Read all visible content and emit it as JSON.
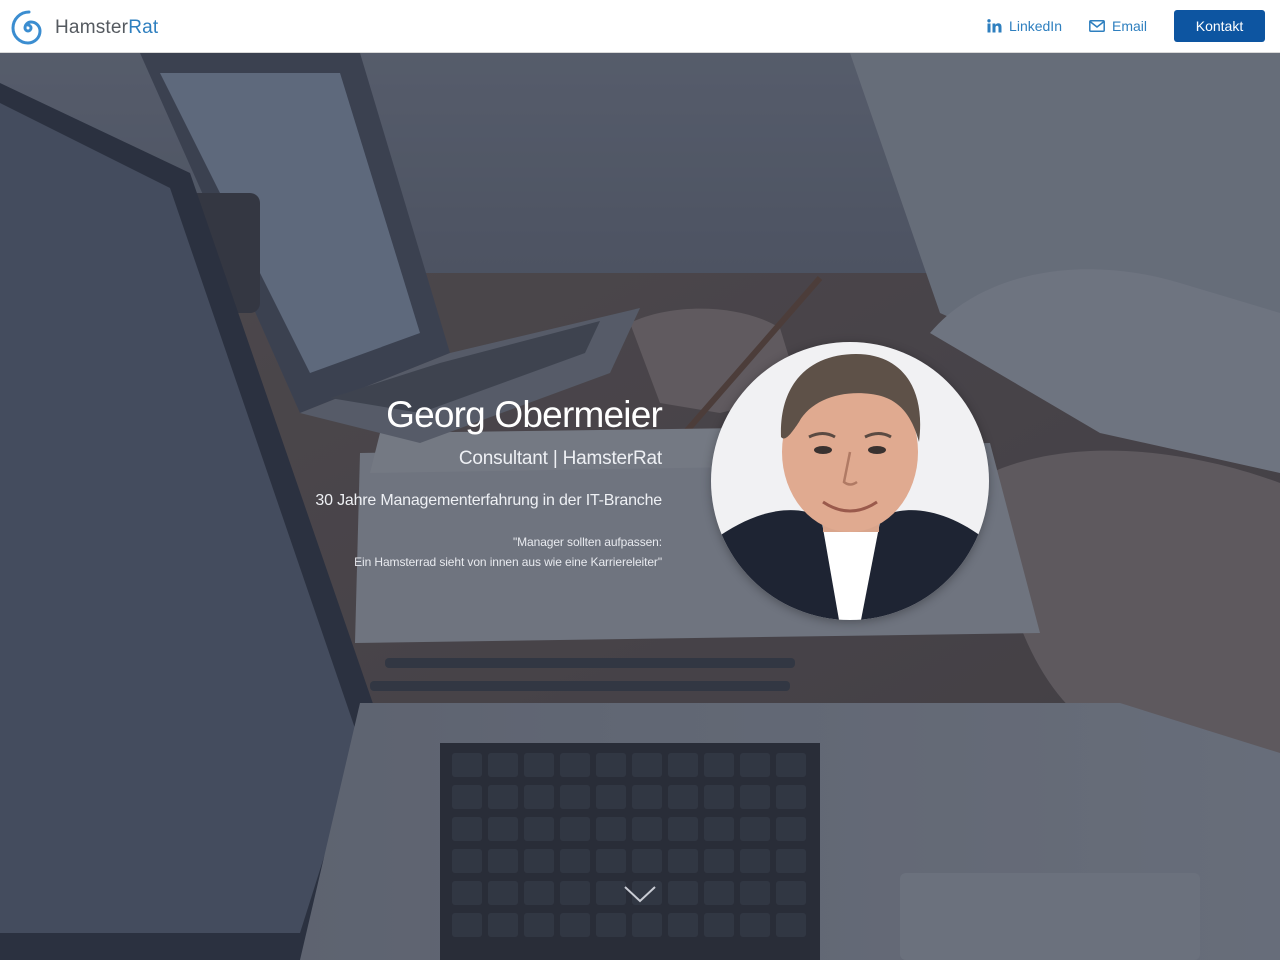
{
  "brand": {
    "name_part1": "Hamster",
    "name_part2": "Rat"
  },
  "nav": {
    "linkedin_label": "LinkedIn",
    "email_label": "Email",
    "contact_label": "Kontakt"
  },
  "hero": {
    "name": "Georg Obermeier",
    "role": "Consultant | HamsterRat",
    "experience": "30 Jahre Managementerfahrung in der IT-Branche",
    "quote_line1": "\"Manager sollten aufpassen:",
    "quote_line2": "Ein Hamsterrad sieht von innen aus wie eine Karriereleiter\""
  },
  "colors": {
    "accent": "#2e7fbf",
    "button": "#0d55a1",
    "overlay": "#3b4150"
  },
  "icons": [
    "spiral-logo-icon",
    "linkedin-icon",
    "email-icon",
    "chevron-down-icon"
  ]
}
